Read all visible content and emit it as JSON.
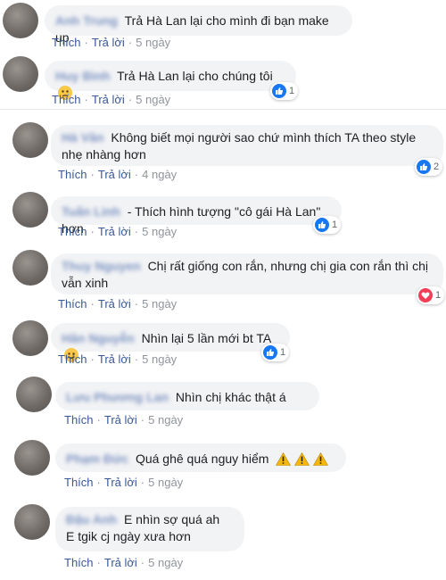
{
  "actions": {
    "like": "Thích",
    "reply": "Trả lời",
    "separator": "·"
  },
  "comments": [
    {
      "author": "Anh Trung",
      "text": "Trả Hà Lan lại cho mình đi bạn make up",
      "time": "5 ngày"
    },
    {
      "author": "Huy Bình",
      "text": "Trả Hà Lan lại cho chúng tôi",
      "time": "5 ngày",
      "reaction_count": "1"
    },
    {
      "author": "Hà Vân",
      "text": "Không biết mọi người sao chứ mình thích TA theo style nhẹ nhàng hơn",
      "time": "4 ngày",
      "reaction_count": "2"
    },
    {
      "author": "Tuấn Linh",
      "text": "- Thích hình tượng \"cô gái Hà Lan\" hơn",
      "time": "5 ngày",
      "reaction_count": "1"
    },
    {
      "author": "Thuy Nguyen",
      "text": "Chị rất giống con rắn, nhưng chị gia con rắn thì chị vẫn xinh",
      "time": "5 ngày",
      "reaction_count": "1"
    },
    {
      "author": "Hân Nguyễn",
      "text": "Nhìn lại 5 lần mới bt TA",
      "time": "5 ngày",
      "reaction_count": "1"
    },
    {
      "author": "Lưu Phương Lan",
      "text": "Nhìn chị khác thật á",
      "time": "5 ngày"
    },
    {
      "author": "Phạm Đức",
      "text": "Quá ghê quá nguy hiểm",
      "time": "5 ngày"
    },
    {
      "author": "Đậu Anh",
      "text": "E nhìn sợ quá ah",
      "text2": "E tgik cj ngày xưa hơn",
      "time": "5 ngày"
    }
  ],
  "colors": {
    "link": "#385898",
    "meta": "#90949c",
    "bubble": "#f2f3f5",
    "like": "#1877f2",
    "heart": "#f33e58"
  }
}
